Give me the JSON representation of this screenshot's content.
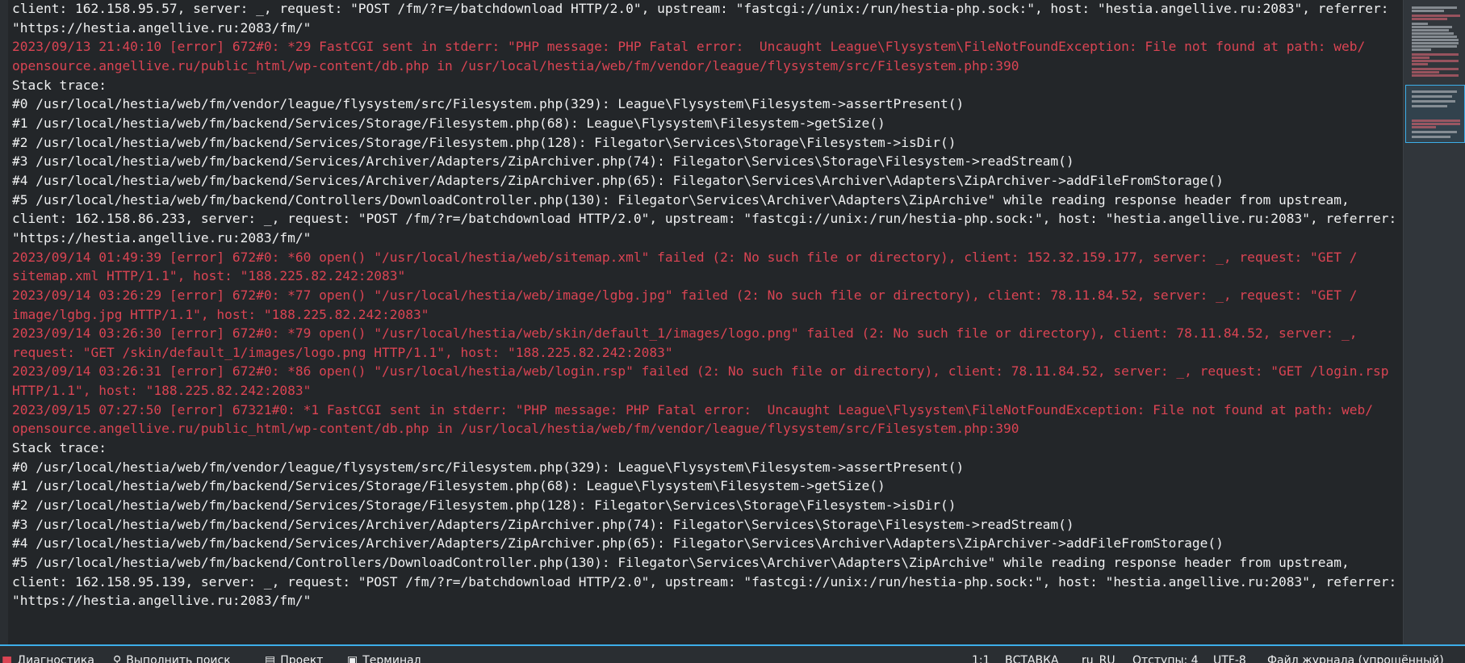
{
  "log_lines": [
    {
      "type": "normal",
      "text": "client: 162.158.95.57, server: _, request: \"POST /fm/?r=/batchdownload HTTP/2.0\", upstream: \"fastcgi://unix:/run/hestia-php.sock:\", host: \"hestia.angellive.ru:2083\", referrer:"
    },
    {
      "type": "normal",
      "text": "\"https://hestia.angellive.ru:2083/fm/\""
    },
    {
      "type": "error",
      "text": "2023/09/13 21:40:10 [error] 672#0: *29 FastCGI sent in stderr: \"PHP message: PHP Fatal error:  Uncaught League\\Flysystem\\FileNotFoundException: File not found at path: web/"
    },
    {
      "type": "error",
      "text": "opensource.angellive.ru/public_html/wp-content/db.php in /usr/local/hestia/web/fm/vendor/league/flysystem/src/Filesystem.php:390"
    },
    {
      "type": "normal",
      "text": "Stack trace:"
    },
    {
      "type": "normal",
      "text": "#0 /usr/local/hestia/web/fm/vendor/league/flysystem/src/Filesystem.php(329): League\\Flysystem\\Filesystem->assertPresent()"
    },
    {
      "type": "normal",
      "text": "#1 /usr/local/hestia/web/fm/backend/Services/Storage/Filesystem.php(68): League\\Flysystem\\Filesystem->getSize()"
    },
    {
      "type": "normal",
      "text": "#2 /usr/local/hestia/web/fm/backend/Services/Storage/Filesystem.php(128): Filegator\\Services\\Storage\\Filesystem->isDir()"
    },
    {
      "type": "normal",
      "text": "#3 /usr/local/hestia/web/fm/backend/Services/Archiver/Adapters/ZipArchiver.php(74): Filegator\\Services\\Storage\\Filesystem->readStream()"
    },
    {
      "type": "normal",
      "text": "#4 /usr/local/hestia/web/fm/backend/Services/Archiver/Adapters/ZipArchiver.php(65): Filegator\\Services\\Archiver\\Adapters\\ZipArchiver->addFileFromStorage()"
    },
    {
      "type": "normal",
      "text": "#5 /usr/local/hestia/web/fm/backend/Controllers/DownloadController.php(130): Filegator\\Services\\Archiver\\Adapters\\ZipArchive\" while reading response header from upstream,"
    },
    {
      "type": "normal",
      "text": "client: 162.158.86.233, server: _, request: \"POST /fm/?r=/batchdownload HTTP/2.0\", upstream: \"fastcgi://unix:/run/hestia-php.sock:\", host: \"hestia.angellive.ru:2083\", referrer:"
    },
    {
      "type": "normal",
      "text": "\"https://hestia.angellive.ru:2083/fm/\""
    },
    {
      "type": "error",
      "text": "2023/09/14 01:49:39 [error] 672#0: *60 open() \"/usr/local/hestia/web/sitemap.xml\" failed (2: No such file or directory), client: 152.32.159.177, server: _, request: \"GET /"
    },
    {
      "type": "error",
      "text": "sitemap.xml HTTP/1.1\", host: \"188.225.82.242:2083\""
    },
    {
      "type": "error",
      "text": "2023/09/14 03:26:29 [error] 672#0: *77 open() \"/usr/local/hestia/web/image/lgbg.jpg\" failed (2: No such file or directory), client: 78.11.84.52, server: _, request: \"GET /"
    },
    {
      "type": "error",
      "text": "image/lgbg.jpg HTTP/1.1\", host: \"188.225.82.242:2083\""
    },
    {
      "type": "error",
      "text": "2023/09/14 03:26:30 [error] 672#0: *79 open() \"/usr/local/hestia/web/skin/default_1/images/logo.png\" failed (2: No such file or directory), client: 78.11.84.52, server: _,"
    },
    {
      "type": "error",
      "text": "request: \"GET /skin/default_1/images/logo.png HTTP/1.1\", host: \"188.225.82.242:2083\""
    },
    {
      "type": "error",
      "text": "2023/09/14 03:26:31 [error] 672#0: *86 open() \"/usr/local/hestia/web/login.rsp\" failed (2: No such file or directory), client: 78.11.84.52, server: _, request: \"GET /login.rsp"
    },
    {
      "type": "error",
      "text": "HTTP/1.1\", host: \"188.225.82.242:2083\""
    },
    {
      "type": "error",
      "text": "2023/09/15 07:27:50 [error] 67321#0: *1 FastCGI sent in stderr: \"PHP message: PHP Fatal error:  Uncaught League\\Flysystem\\FileNotFoundException: File not found at path: web/"
    },
    {
      "type": "error",
      "text": "opensource.angellive.ru/public_html/wp-content/db.php in /usr/local/hestia/web/fm/vendor/league/flysystem/src/Filesystem.php:390"
    },
    {
      "type": "normal",
      "text": "Stack trace:"
    },
    {
      "type": "normal",
      "text": "#0 /usr/local/hestia/web/fm/vendor/league/flysystem/src/Filesystem.php(329): League\\Flysystem\\Filesystem->assertPresent()"
    },
    {
      "type": "normal",
      "text": "#1 /usr/local/hestia/web/fm/backend/Services/Storage/Filesystem.php(68): League\\Flysystem\\Filesystem->getSize()"
    },
    {
      "type": "normal",
      "text": "#2 /usr/local/hestia/web/fm/backend/Services/Storage/Filesystem.php(128): Filegator\\Services\\Storage\\Filesystem->isDir()"
    },
    {
      "type": "normal",
      "text": "#3 /usr/local/hestia/web/fm/backend/Services/Archiver/Adapters/ZipArchiver.php(74): Filegator\\Services\\Storage\\Filesystem->readStream()"
    },
    {
      "type": "normal",
      "text": "#4 /usr/local/hestia/web/fm/backend/Services/Archiver/Adapters/ZipArchiver.php(65): Filegator\\Services\\Archiver\\Adapters\\ZipArchiver->addFileFromStorage()"
    },
    {
      "type": "normal",
      "text": "#5 /usr/local/hestia/web/fm/backend/Controllers/DownloadController.php(130): Filegator\\Services\\Archiver\\Adapters\\ZipArchive\" while reading response header from upstream,"
    },
    {
      "type": "normal",
      "text": "client: 162.158.95.139, server: _, request: \"POST /fm/?r=/batchdownload HTTP/2.0\", upstream: \"fastcgi://unix:/run/hestia-php.sock:\", host: \"hestia.angellive.ru:2083\", referrer:"
    },
    {
      "type": "normal",
      "text": "\"https://hestia.angellive.ru:2083/fm/\""
    },
    {
      "type": "normal",
      "text": ""
    }
  ],
  "status_bar": {
    "diagnostics": "Диагностика",
    "search": "Выполнить поиск",
    "project": "Проект",
    "terminal": "Терминал",
    "cursor": "1:1",
    "mode": "ВСТАВКА",
    "language": "ru_RU",
    "indent": "Отступы: 4",
    "encoding": "UTF-8",
    "file_type": "Файл журнала (упрощённый)"
  },
  "icons": {
    "diagnostics": "diagnostics-icon",
    "search": "search-icon",
    "project": "project-folder-icon",
    "terminal": "terminal-icon"
  },
  "colors": {
    "background": "#232629",
    "text": "#eff0f1",
    "error": "#da4453",
    "accent": "#3daee9",
    "statusbar": "#2a2e32"
  },
  "spellcheck_words": [
    "batchdownload",
    "hestia",
    "angellive",
    "FastCGI",
    "stderr",
    "Flysystem",
    "FileNotFoundException",
    "opensource",
    "public_html",
    "wp",
    "usr",
    "flysystem",
    "Filesystem",
    "assertPresent",
    "getSize",
    "backend",
    "Filegator",
    "isDir",
    "ZipArchiver",
    "readStream",
    "addFileFromStorage",
    "DownloadController",
    "ZipArchive",
    "xml",
    "lgbg",
    "jpg",
    "default_1",
    "png",
    "rsp",
    "sitemap",
    "fm"
  ]
}
